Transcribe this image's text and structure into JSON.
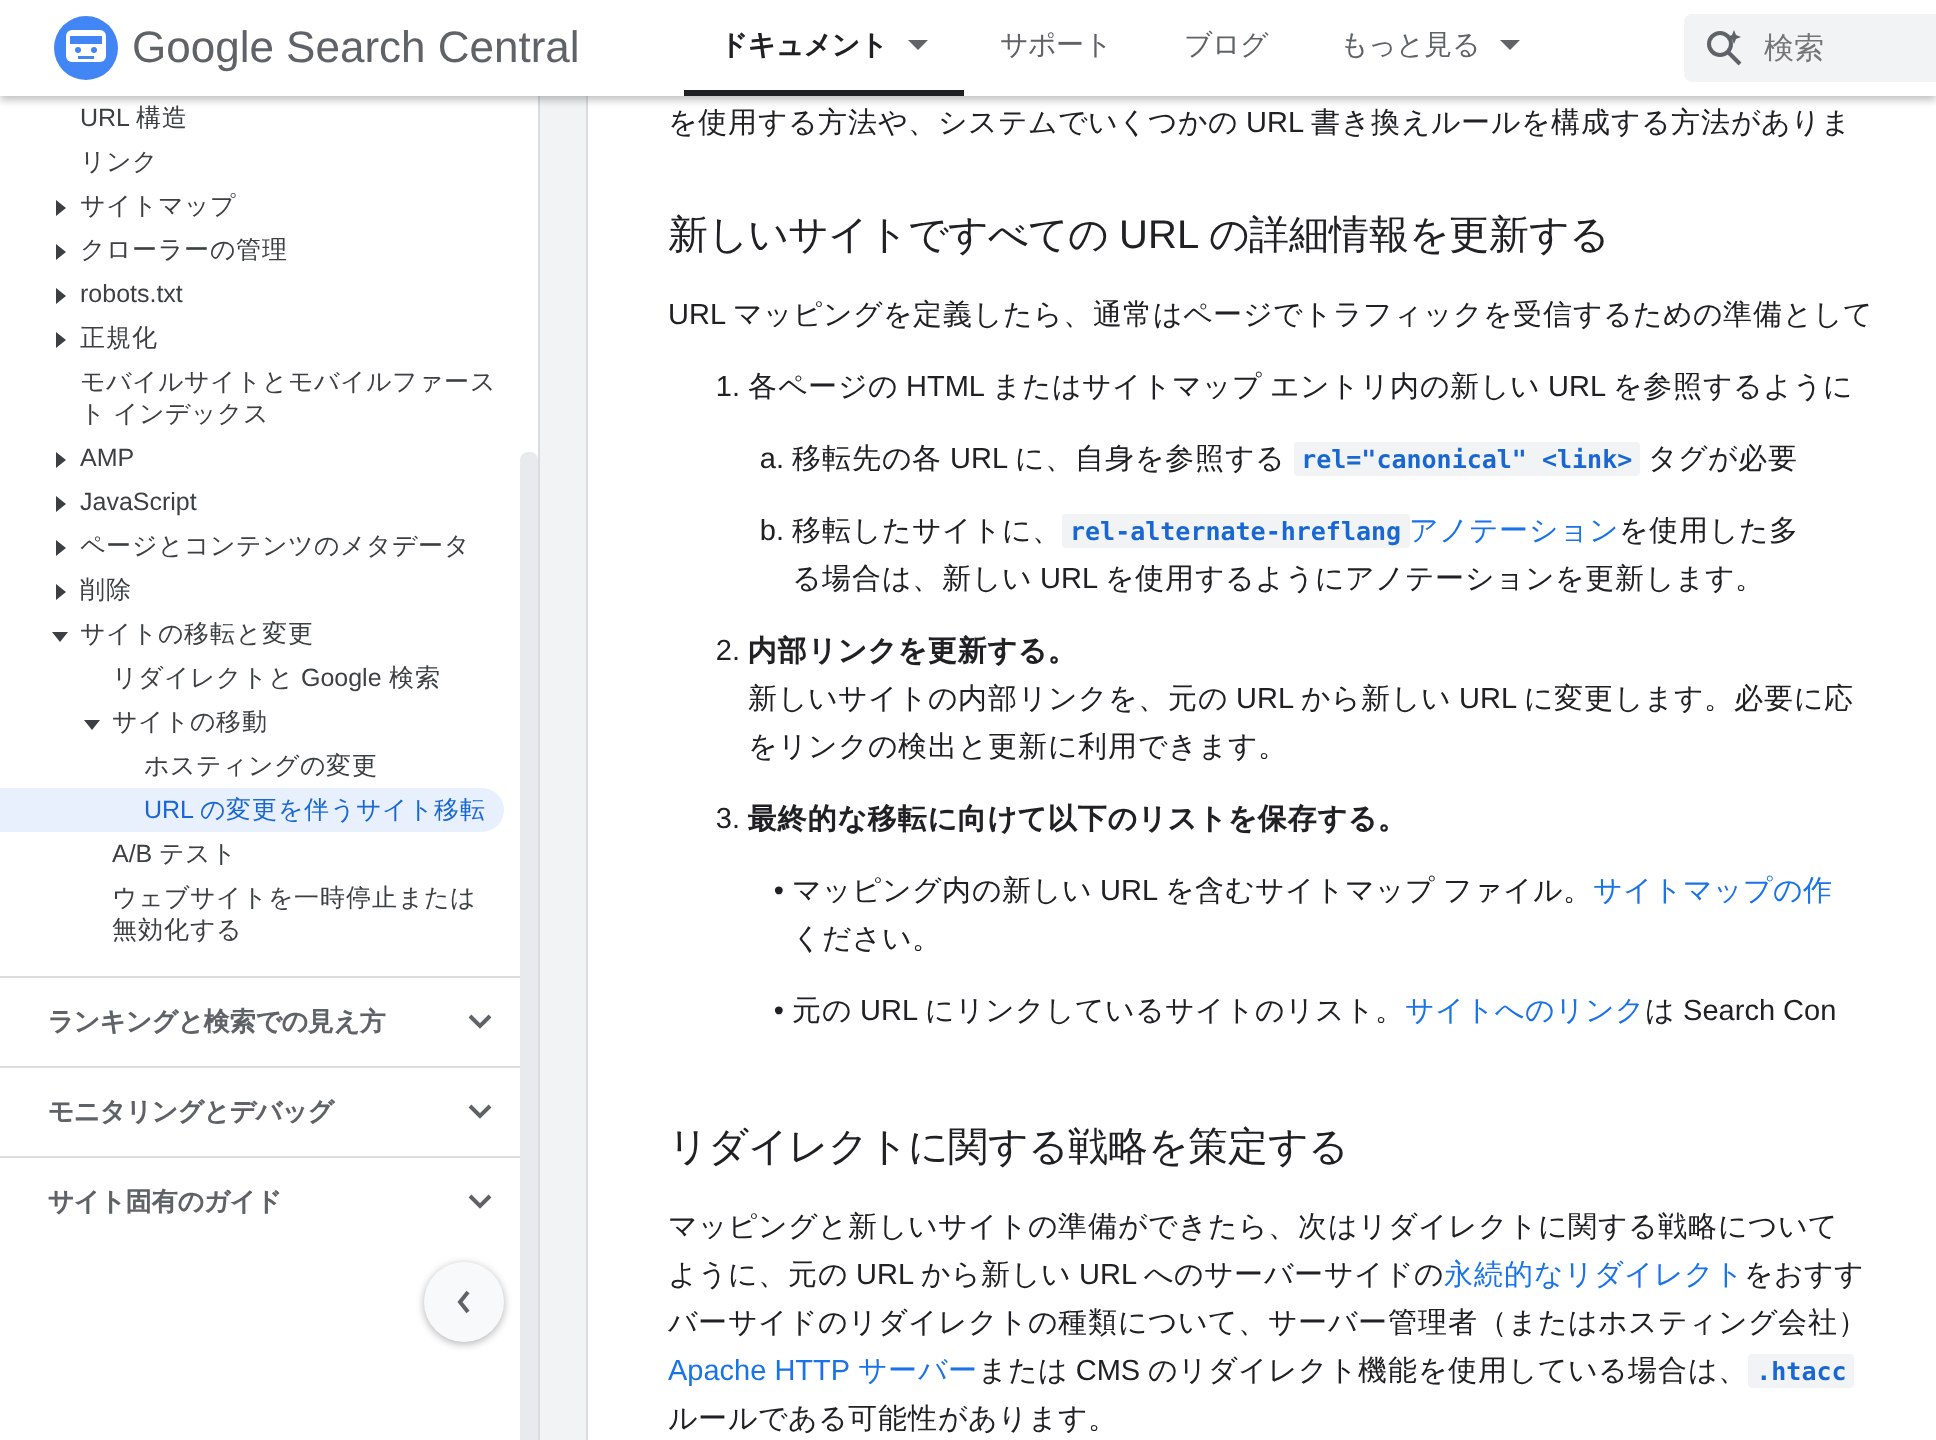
{
  "header": {
    "logo_text": "Google Search Central",
    "tabs": [
      {
        "label": "ドキュメント",
        "selected": true,
        "dropdown": true
      },
      {
        "label": "サポート",
        "selected": false,
        "dropdown": false
      },
      {
        "label": "ブログ",
        "selected": false,
        "dropdown": false
      },
      {
        "label": "もっと見る",
        "selected": false,
        "dropdown": true
      }
    ],
    "search": {
      "placeholder": "検索"
    }
  },
  "sidebar": {
    "items": [
      {
        "label": "URL 構造",
        "selected": false
      },
      {
        "label": "リンク",
        "selected": false
      },
      {
        "label": "サイトマップ",
        "selected": false,
        "expanded": false
      },
      {
        "label": "クローラーの管理",
        "selected": false,
        "expanded": false
      },
      {
        "label": "robots.txt",
        "selected": false,
        "expanded": false
      },
      {
        "label": "正規化",
        "selected": false,
        "expanded": false
      },
      {
        "label": "モバイルサイトとモバイルファースト インデックス",
        "selected": false
      },
      {
        "label": "AMP",
        "selected": false,
        "expanded": false
      },
      {
        "label": "JavaScript",
        "selected": false,
        "expanded": false
      },
      {
        "label": "ページとコンテンツのメタデータ",
        "selected": false,
        "expanded": false
      },
      {
        "label": "削除",
        "selected": false,
        "expanded": false
      },
      {
        "label": "サイトの移転と変更",
        "selected": false,
        "expanded": true,
        "children": [
          {
            "label": "リダイレクトと Google 検索",
            "selected": false
          },
          {
            "label": "サイトの移動",
            "selected": false,
            "expanded": true,
            "children": [
              {
                "label": "ホスティングの変更",
                "selected": false
              },
              {
                "label": "URL の変更を伴うサイト移転",
                "selected": true
              }
            ]
          },
          {
            "label": "A/B テスト",
            "selected": false
          },
          {
            "label": "ウェブサイトを一時停止または無効化する",
            "selected": false
          }
        ]
      }
    ],
    "sections": [
      {
        "label": "ランキングと検索での見え方",
        "expanded": false
      },
      {
        "label": "モニタリングとデバッグ",
        "expanded": false
      },
      {
        "label": "サイト固有のガイド",
        "expanded": false
      }
    ]
  },
  "content": {
    "blocks": [
      {
        "kind": "p",
        "lines": [
          [
            {
              "kind": "text",
              "text": "を使用する方法や、システムでいくつかの URL 書き換えルールを構成する方法がありま"
            }
          ]
        ]
      },
      {
        "kind": "h2",
        "text": "新しいサイトですべての URL の詳細情報を更新する"
      },
      {
        "kind": "p",
        "lines": [
          [
            {
              "kind": "text",
              "text": "URL マッピングを定義したら、通常はページでトラフィックを受信するための準備として"
            }
          ]
        ]
      },
      {
        "kind": "item",
        "marker": "1.",
        "lines": [
          [
            {
              "kind": "text",
              "text": "各ページの HTML またはサイトマップ エントリ内の新しい URL を参照するように"
            }
          ]
        ],
        "children": [
          {
            "marker": "a.",
            "lines": [
              [
                {
                  "kind": "text",
                  "text": "移転先の各 URL に、自身を参照する "
                },
                {
                  "kind": "code",
                  "text": "rel=\"canonical\" <link>"
                },
                {
                  "kind": "text",
                  "text": " タグが必要"
                }
              ]
            ]
          },
          {
            "marker": "b.",
            "lines": [
              [
                {
                  "kind": "text",
                  "text": "移転したサイトに、"
                },
                {
                  "kind": "code",
                  "text": "rel-alternate-hreflang"
                },
                {
                  "kind": "link",
                  "text": "アノテーション"
                },
                {
                  "kind": "text",
                  "text": "を使用した多"
                }
              ],
              [
                {
                  "kind": "text",
                  "text": "る場合は、新しい URL を使用するようにアノテーションを更新します。"
                }
              ]
            ]
          }
        ]
      },
      {
        "kind": "item",
        "marker": "2.",
        "lines": [
          [
            {
              "kind": "bold",
              "text": "内部リンクを更新する。"
            }
          ],
          [
            {
              "kind": "text",
              "text": "新しいサイトの内部リンクを、元の URL から新しい URL に変更します。必要に応"
            }
          ],
          [
            {
              "kind": "text",
              "text": "をリンクの検出と更新に利用できます。"
            }
          ]
        ]
      },
      {
        "kind": "item",
        "marker": "3.",
        "lines": [
          [
            {
              "kind": "bold",
              "text": "最終的な移転に向けて以下のリストを保存する。"
            }
          ]
        ],
        "children": [
          {
            "marker": "•",
            "lines": [
              [
                {
                  "kind": "text",
                  "text": "マッピング内の新しい URL を含むサイトマップ ファイル。"
                },
                {
                  "kind": "link",
                  "text": "サイトマップの作"
                }
              ],
              [
                {
                  "kind": "text",
                  "text": "ください。"
                }
              ]
            ]
          },
          {
            "marker": "•",
            "lines": [
              [
                {
                  "kind": "text",
                  "text": "元の URL にリンクしているサイトのリスト。"
                },
                {
                  "kind": "link",
                  "text": "サイトへのリンク"
                },
                {
                  "kind": "text",
                  "text": "は Search Con"
                }
              ]
            ]
          }
        ]
      },
      {
        "kind": "h2",
        "text": "リダイレクトに関する戦略を策定する"
      },
      {
        "kind": "p",
        "lines": [
          [
            {
              "kind": "text",
              "text": "マッピングと新しいサイトの準備ができたら、次はリダイレクトに関する戦略について"
            }
          ],
          [
            {
              "kind": "text",
              "text": "ように、元の URL から新しい URL へのサーバーサイドの"
            },
            {
              "kind": "link",
              "text": "永続的なリダイレクト"
            },
            {
              "kind": "text",
              "text": "をおすす"
            }
          ],
          [
            {
              "kind": "text",
              "text": "バーサイドのリダイレクトの種類について、サーバー管理者（またはホスティング会社）"
            }
          ],
          [
            {
              "kind": "link",
              "text": "Apache HTTP サーバー"
            },
            {
              "kind": "text",
              "text": "または CMS のリダイレクト機能を使用している場合は、"
            },
            {
              "kind": "code",
              "text": ".htacc"
            }
          ],
          [
            {
              "kind": "text",
              "text": "ルールである可能性があります。"
            }
          ]
        ]
      }
    ]
  }
}
